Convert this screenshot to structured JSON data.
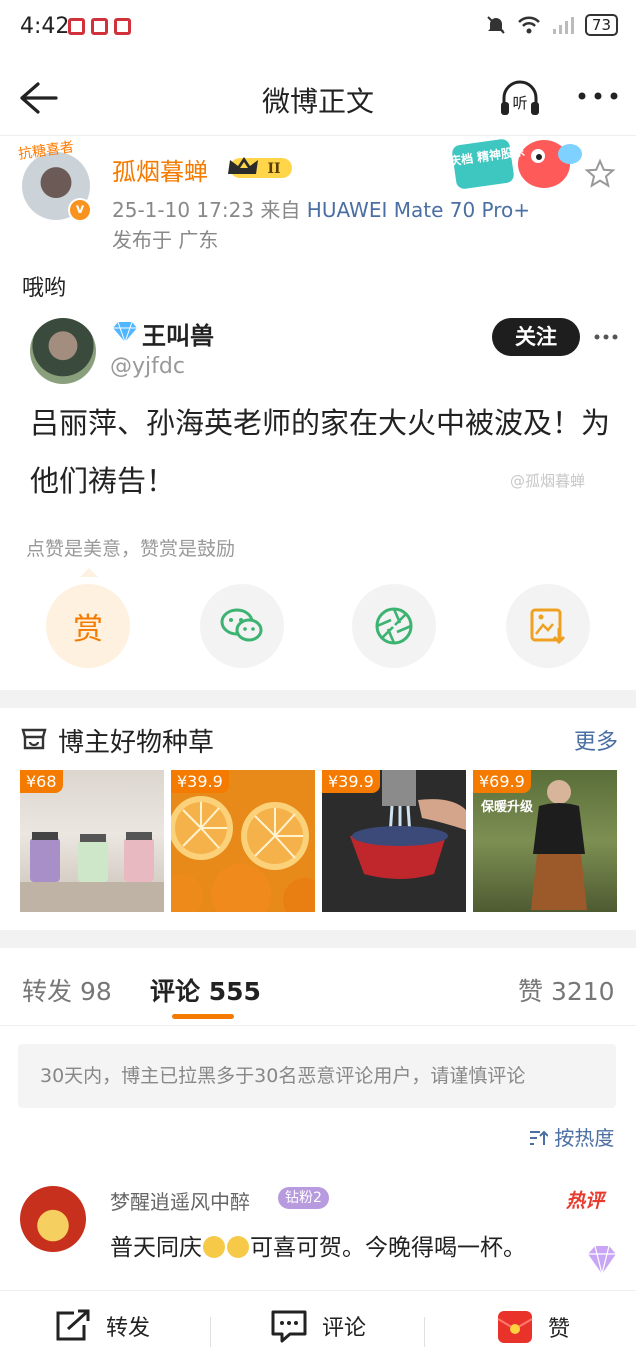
{
  "status_bar": {
    "time": "4:42",
    "battery": "73"
  },
  "top_bar": {
    "title": "微博正文",
    "listen_label": "听"
  },
  "author": {
    "avatar_tag": "抗糖喜者",
    "v_badge": "v",
    "name": "孤烟暮蝉",
    "vip_level": "II",
    "timestamp": "25-1-10 17:23",
    "source_prefix": "来自",
    "device": "HUAWEI Mate 70 Pro+",
    "location": "发布于 广东",
    "event_badge": "国庆档 精神股东"
  },
  "post": {
    "text": "哦哟"
  },
  "retweet": {
    "name": "王叫兽",
    "handle": "@yjfdc",
    "follow_label": "关注",
    "text": "吕丽萍、孙海英老师的家在大火中被波及！为他们祷告！",
    "watermark": "@孤烟暮蝉"
  },
  "actions": {
    "hint": "点赞是美意，赞赏是鼓励",
    "reward_label": "赏"
  },
  "shop": {
    "title": "博主好物种草",
    "more": "更多",
    "products": [
      {
        "price": "¥68",
        "subtitle": ""
      },
      {
        "price": "¥39.9",
        "subtitle": ""
      },
      {
        "price": "¥39.9",
        "subtitle": ""
      },
      {
        "price": "¥69.9",
        "subtitle": "保暖升级"
      }
    ]
  },
  "tabs": {
    "repost": "转发 98",
    "comments": "评论 555",
    "likes": "赞 3210"
  },
  "notice": "30天内，博主已拉黑多于30名恶意评论用户，请谨慎评论",
  "sort_label": "按热度",
  "comment": {
    "user": "梦醒逍遥风中醉",
    "fan_badge": "钻粉2",
    "hot_badge": "热评",
    "text_a": "普天同庆",
    "text_b": "可喜可贺。今晚得喝一杯。"
  },
  "bottom_bar": {
    "repost": "转发",
    "comment": "评论",
    "like": "赞"
  },
  "colors": {
    "accent_orange": "#f57b00",
    "link_blue": "#4b6fa3",
    "hot_red": "#e83b2e"
  }
}
